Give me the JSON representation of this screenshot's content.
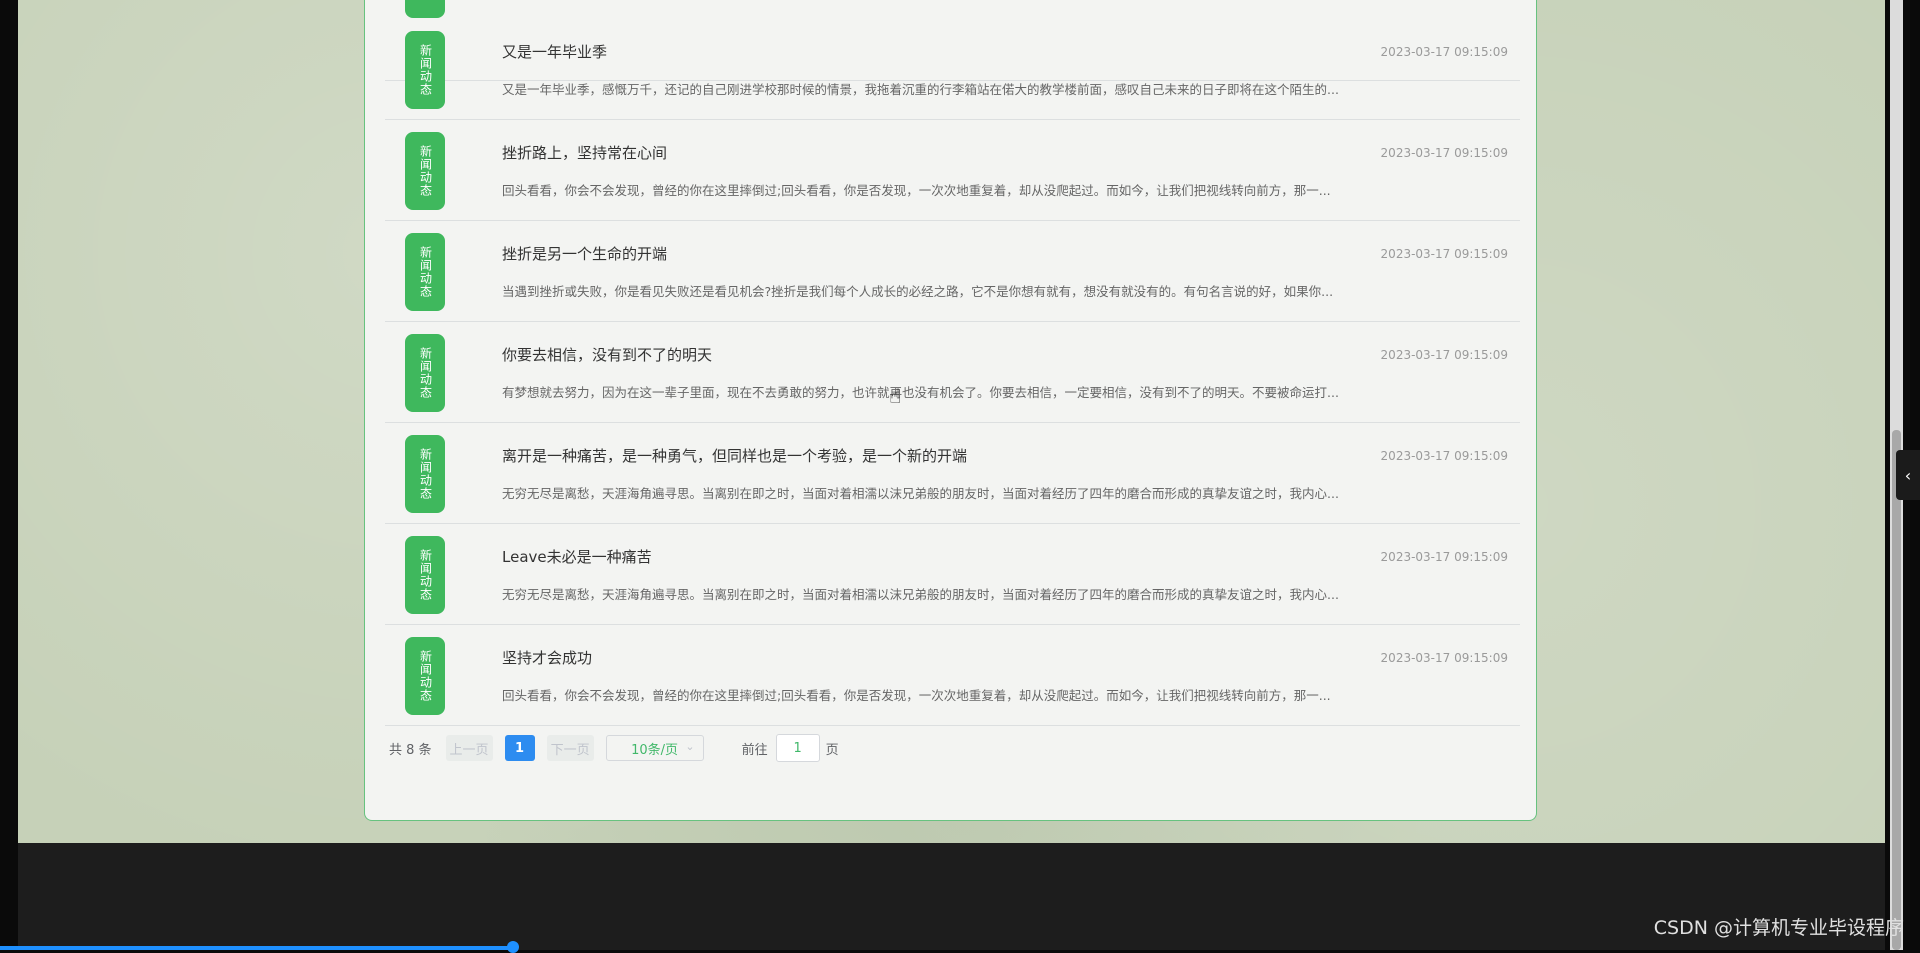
{
  "news": {
    "badge_label": "新闻动态",
    "items": [
      {
        "title": "",
        "date": "",
        "summary": ""
      },
      {
        "title": "又是一年毕业季",
        "date": "2023-03-17 09:15:09",
        "summary": "又是一年毕业季，感慨万千，还记的自己刚进学校那时候的情景，我拖着沉重的行李箱站在偌大的教学楼前面，感叹自己未来的日子即将在这个陌生的..."
      },
      {
        "title": "挫折路上，坚持常在心间",
        "date": "2023-03-17 09:15:09",
        "summary": "回头看看，你会不会发现，曾经的你在这里摔倒过;回头看看，你是否发现，一次次地重复着，却从没爬起过。而如今，让我们把视线转向前方，那一..."
      },
      {
        "title": "挫折是另一个生命的开端",
        "date": "2023-03-17 09:15:09",
        "summary": "当遇到挫折或失败，你是看见失败还是看见机会?挫折是我们每个人成长的必经之路，它不是你想有就有，想没有就没有的。有句名言说的好，如果你..."
      },
      {
        "title": "你要去相信，没有到不了的明天",
        "date": "2023-03-17 09:15:09",
        "summary": "有梦想就去努力，因为在这一辈子里面，现在不去勇敢的努力，也许就再也没有机会了。你要去相信，一定要相信，没有到不了的明天。不要被命运打..."
      },
      {
        "title": "离开是一种痛苦，是一种勇气，但同样也是一个考验，是一个新的开端",
        "date": "2023-03-17 09:15:09",
        "summary": "无穷无尽是离愁，天涯海角遍寻思。当离别在即之时，当面对着相濡以沫兄弟般的朋友时，当面对着经历了四年的磨合而形成的真挚友谊之时，我内心..."
      },
      {
        "title": "Leave未必是一种痛苦",
        "date": "2023-03-17 09:15:09",
        "summary": "无穷无尽是离愁，天涯海角遍寻思。当离别在即之时，当面对着相濡以沫兄弟般的朋友时，当面对着经历了四年的磨合而形成的真挚友谊之时，我内心..."
      },
      {
        "title": "坚持才会成功",
        "date": "2023-03-17 09:15:09",
        "summary": "回头看看，你会不会发现，曾经的你在这里摔倒过;回头看看，你是否发现，一次次地重复着，却从没爬起过。而如今，让我们把视线转向前方，那一..."
      }
    ]
  },
  "pager": {
    "total": "共 8 条",
    "prev": "上一页",
    "page": "1",
    "next": "下一页",
    "page_size": "10条/页",
    "goto_label": "前往",
    "goto_value": "1",
    "page_unit": "页"
  },
  "watermark": "CSDN @计算机专业毕设程序",
  "icons": {
    "side_toggle": "chevron-left-icon",
    "size_chevron": "chevron-down-icon",
    "cursor": "hand-pointer-icon"
  },
  "colors": {
    "badge": "#3fb85d",
    "accent": "#2d8cf0",
    "panel_border": "#67c27f"
  }
}
